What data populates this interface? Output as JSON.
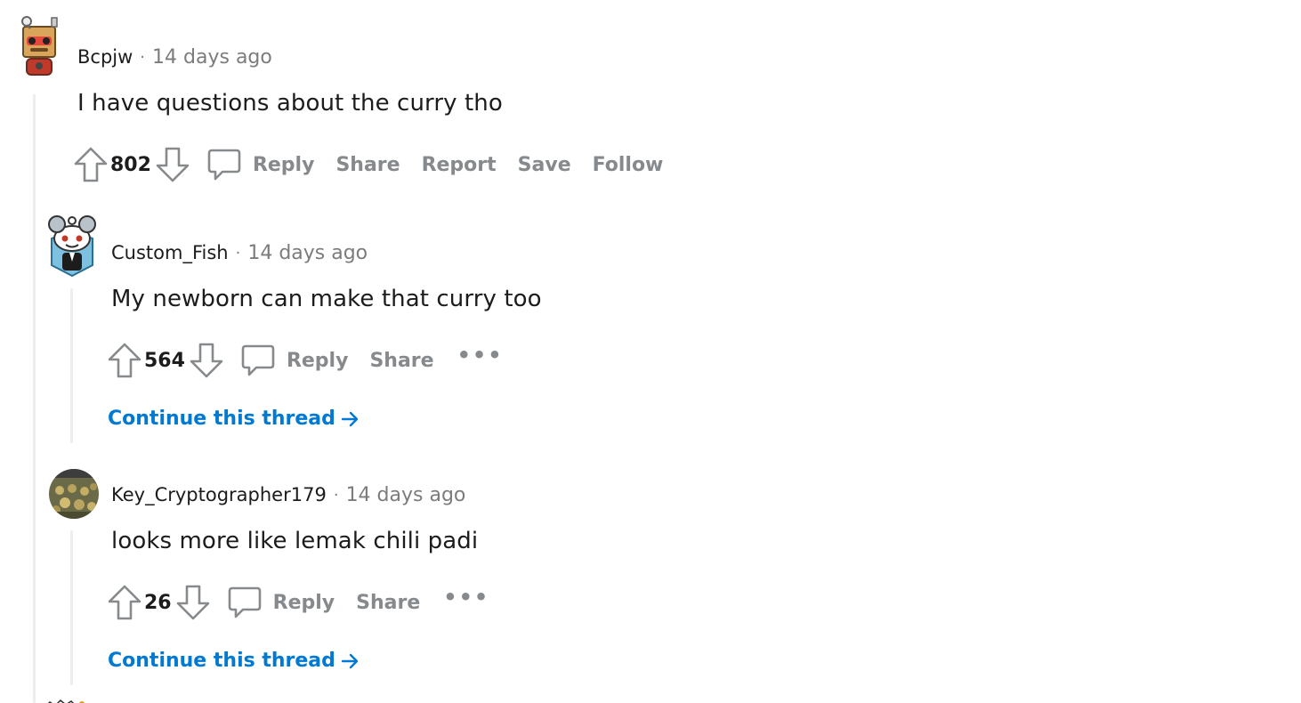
{
  "comments": [
    {
      "username": "Bcpjw",
      "time": "14 days ago",
      "body": "I have questions about the curry tho",
      "score": "802",
      "actions": {
        "reply": "Reply",
        "share": "Share",
        "report": "Report",
        "save": "Save",
        "follow": "Follow"
      }
    },
    {
      "username": "Custom_Fish",
      "time": "14 days ago",
      "body": "My newborn can make that curry too",
      "score": "564",
      "actions": {
        "reply": "Reply",
        "share": "Share"
      },
      "continue": "Continue this thread"
    },
    {
      "username": "Key_Cryptographer179",
      "time": "14 days ago",
      "body": "looks more like lemak chili padi",
      "score": "26",
      "actions": {
        "reply": "Reply",
        "share": "Share"
      },
      "continue": "Continue this thread"
    }
  ],
  "separator": "·",
  "more_label": "•••",
  "colors": {
    "link": "#0079d3",
    "muted": "#878a8c",
    "thread_line": "#ebedef"
  },
  "icons": [
    "upvote-icon",
    "downvote-icon",
    "comment-bubble-icon",
    "arrow-right-icon"
  ]
}
